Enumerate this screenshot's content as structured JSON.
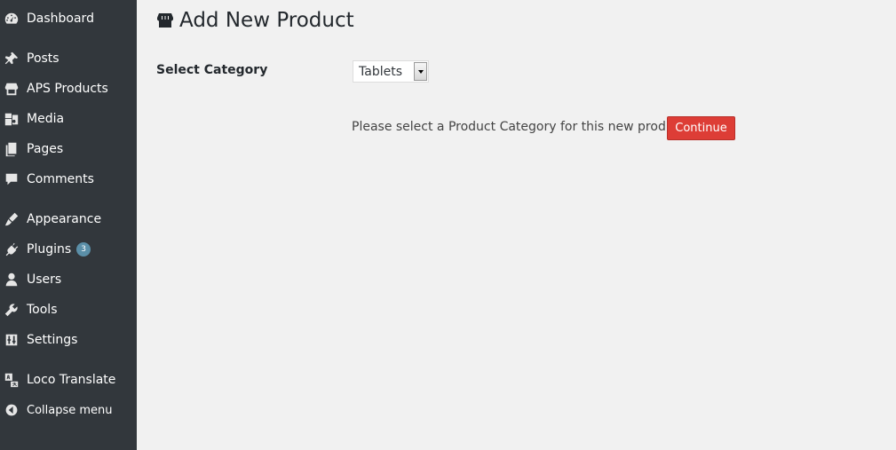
{
  "sidebar": {
    "items": [
      {
        "label": "Dashboard",
        "icon": "dashboard-icon"
      },
      {
        "label": "Posts",
        "icon": "pin-icon"
      },
      {
        "label": "APS Products",
        "icon": "store-icon"
      },
      {
        "label": "Media",
        "icon": "media-icon"
      },
      {
        "label": "Pages",
        "icon": "pages-icon"
      },
      {
        "label": "Comments",
        "icon": "comment-icon"
      },
      {
        "label": "Appearance",
        "icon": "brush-icon"
      },
      {
        "label": "Plugins",
        "icon": "plug-icon",
        "badge": "3"
      },
      {
        "label": "Users",
        "icon": "user-icon"
      },
      {
        "label": "Tools",
        "icon": "wrench-icon"
      },
      {
        "label": "Settings",
        "icon": "settings-icon"
      },
      {
        "label": "Loco Translate",
        "icon": "translate-icon"
      }
    ],
    "collapse_label": "Collapse menu"
  },
  "main": {
    "title": "Add New Product",
    "select_label": "Select Category",
    "category_value": "Tablets",
    "prompt": "Please select a Product Category for this new product.",
    "continue_label": "Continue"
  },
  "colors": {
    "sidebar_bg": "#32373c",
    "content_bg": "#f1f1f1",
    "button_red": "#dd3d36",
    "badge_blue": "#5b8fa8"
  }
}
